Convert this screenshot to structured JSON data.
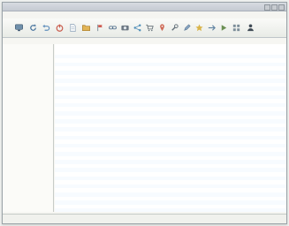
{
  "window": {
    "title": "",
    "menu": [
      "",
      "",
      "",
      "",
      "",
      "",
      ""
    ]
  },
  "toolbar": {
    "icons": [
      "monitor-icon",
      "refresh-icon",
      "undo-icon",
      "power-icon",
      "document-icon",
      "folder-icon",
      "flag-icon",
      "link-icon",
      "camera-icon",
      "share-icon",
      "cart-icon",
      "pin-icon",
      "tools-icon",
      "edit-icon",
      "star-icon",
      "arrow-icon",
      "play-icon",
      "grid-icon",
      "user-icon"
    ]
  },
  "address": {
    "text": ""
  },
  "sidebar": {
    "groups": [
      "",
      ""
    ],
    "items": [
      "",
      "",
      "",
      "",
      "",
      "",
      "",
      "",
      "",
      "",
      "",
      "",
      "",
      "",
      "",
      "",
      "",
      "",
      "",
      "",
      "",
      "",
      "",
      "",
      "",
      "",
      "",
      "",
      "",
      "",
      "",
      ""
    ]
  },
  "table": {
    "headers": [
      "",
      "",
      "",
      "",
      ""
    ],
    "rows": [
      [
        "",
        "",
        "",
        "",
        ""
      ],
      [
        "",
        "",
        "",
        "",
        ""
      ],
      [
        "",
        "",
        "",
        "",
        ""
      ],
      [
        "",
        "",
        "",
        "",
        ""
      ],
      [
        "",
        "",
        "",
        "",
        ""
      ],
      [
        "",
        "",
        "",
        "",
        ""
      ],
      [
        "",
        "",
        "",
        "",
        ""
      ],
      [
        "",
        "",
        "",
        "",
        ""
      ],
      [
        "",
        "",
        "",
        "",
        ""
      ],
      [
        "",
        "",
        "",
        "",
        ""
      ],
      [
        "",
        "",
        "",
        "",
        ""
      ],
      [
        "",
        "",
        "",
        "",
        ""
      ],
      [
        "",
        "",
        "",
        "",
        ""
      ],
      [
        "",
        "",
        "",
        "",
        ""
      ],
      [
        "",
        "",
        "",
        "",
        ""
      ],
      [
        "",
        "",
        "",
        "",
        ""
      ],
      [
        "",
        "",
        "",
        "",
        ""
      ],
      [
        "",
        "",
        "",
        "",
        ""
      ],
      [
        "",
        "",
        "",
        "",
        ""
      ],
      [
        "",
        "",
        "",
        "",
        ""
      ],
      [
        "",
        "",
        "",
        "",
        ""
      ],
      [
        "",
        "",
        "",
        "",
        ""
      ],
      [
        "",
        "",
        "",
        "",
        ""
      ],
      [
        "",
        "",
        "",
        "",
        ""
      ],
      [
        "",
        "",
        "",
        "",
        ""
      ],
      [
        "",
        "",
        "",
        "",
        ""
      ],
      [
        "",
        "",
        "",
        "",
        ""
      ],
      [
        "",
        "",
        "",
        "",
        ""
      ],
      [
        "",
        "",
        "",
        "",
        ""
      ],
      [
        "",
        "",
        "",
        "",
        ""
      ],
      [
        "",
        "",
        "",
        "",
        ""
      ],
      [
        "",
        "",
        "",
        "",
        ""
      ],
      [
        "",
        "",
        "",
        "",
        ""
      ],
      [
        "",
        "",
        "",
        "",
        ""
      ],
      [
        "",
        "",
        "",
        "",
        ""
      ],
      [
        "",
        "",
        "",
        "",
        ""
      ],
      [
        "",
        "",
        "",
        "",
        ""
      ],
      [
        "",
        "",
        "",
        "",
        ""
      ],
      [
        "",
        "",
        "",
        "",
        ""
      ],
      [
        "",
        "",
        "",
        "",
        ""
      ]
    ]
  },
  "status": {
    "text": ""
  },
  "colors": {
    "accent": "#7aa3d0",
    "link": "#2d5e8a",
    "address": "#4f8f38"
  }
}
